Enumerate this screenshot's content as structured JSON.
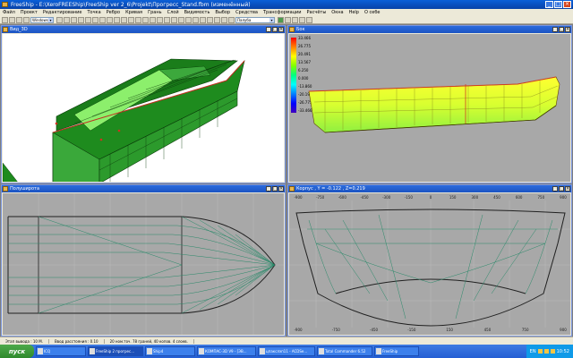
{
  "window": {
    "title": "FreeShip - E:\\XeroFREEShip\\FreeShip ver 2_6\\Projekt\\Прогресс_Stand.fbm (изменённый)"
  },
  "menu": [
    "Файл",
    "Проект",
    "Редактирование",
    "Точка",
    "Ребро",
    "Кривая",
    "Грань",
    "Слой",
    "Видимость",
    "Выбор",
    "Средства",
    "Трансформации",
    "Расчёты",
    "Окна",
    "Help",
    "О себе"
  ],
  "toolbar": {
    "combo_left": "Windows",
    "combo_right": "Палуба"
  },
  "views": {
    "v3d": {
      "title": "Вид_3D"
    },
    "side": {
      "title": "Бок"
    },
    "plan": {
      "title": "Полуширота"
    },
    "body": {
      "title": "Корпус , Y = -0.122 , Z=0.219"
    }
  },
  "colorscale": [
    "33.466",
    "26.775",
    "20.491",
    "13.567",
    "6.250",
    "0.000",
    "-13.860",
    "-20.191",
    "-26.775",
    "-33.466"
  ],
  "body_axis": {
    "top": [
      "-900",
      "-750",
      "-600",
      "-450",
      "-300",
      "-150",
      "0",
      "150",
      "300",
      "450",
      "600",
      "750",
      "900"
    ],
    "bottom": [
      "-900",
      "-750",
      "-450",
      "-150",
      "150",
      "450",
      "750",
      "900"
    ]
  },
  "status": [
    "Этап вывода : 10 М.",
    "Ввод расстояния : 0.10",
    "20 ном.точ. 78 граней, 40 копов. 4 слоев.",
    ""
  ],
  "taskbar": {
    "start": "пуск",
    "items": [
      {
        "label": "ICQ"
      },
      {
        "label": "FreeShip 2 прогрес..."
      },
      {
        "label": "Ship4"
      },
      {
        "label": "КОМПАС-3D V9 - [ЭВ..."
      },
      {
        "label": "цпакслэп11 - ACDSe..."
      },
      {
        "label": "Total Commander 6.52"
      },
      {
        "label": "FreeShip"
      }
    ],
    "lang": "EN",
    "time": "10:52"
  }
}
